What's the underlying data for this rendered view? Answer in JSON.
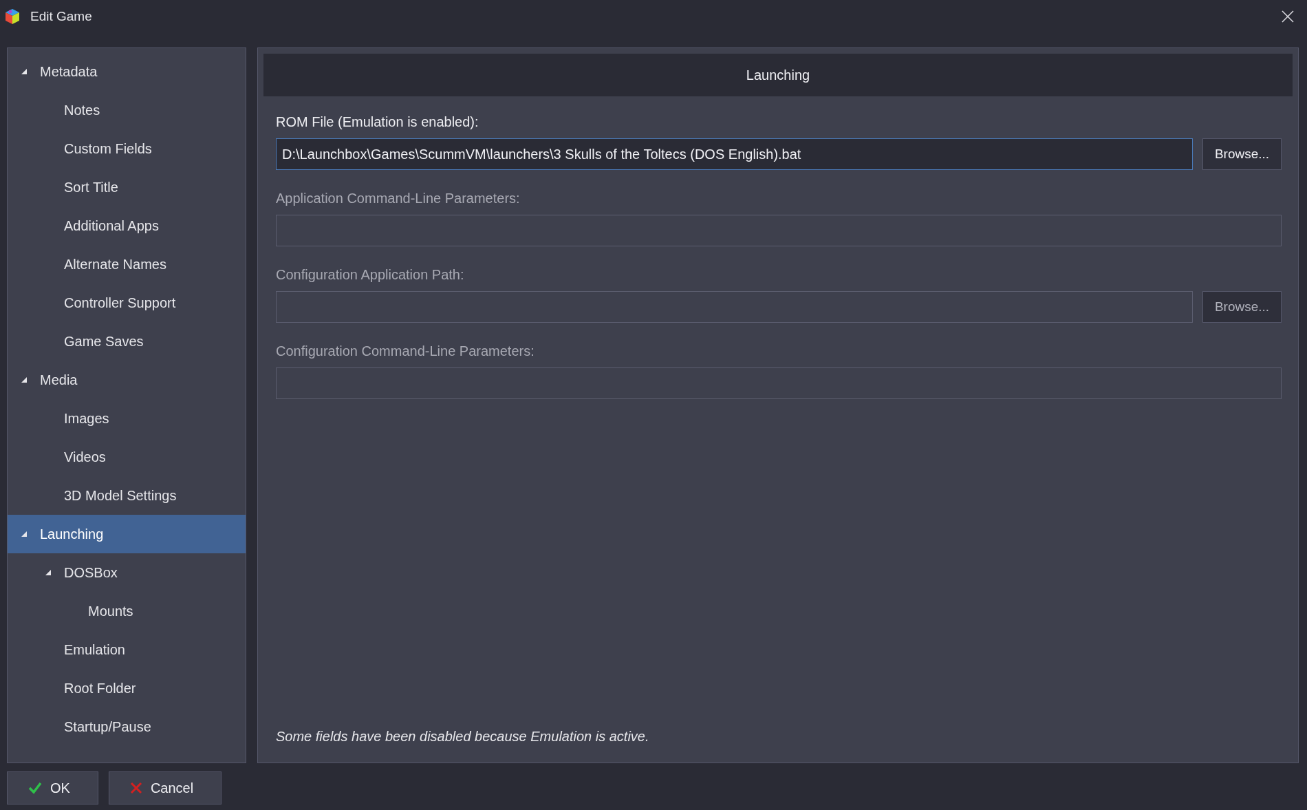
{
  "window": {
    "title": "Edit Game"
  },
  "sidebar": {
    "items": [
      {
        "label": "Metadata",
        "expanded": true,
        "selected": false,
        "children": [
          {
            "label": "Notes",
            "selected": false
          },
          {
            "label": "Custom Fields",
            "selected": false
          },
          {
            "label": "Sort Title",
            "selected": false
          },
          {
            "label": "Additional Apps",
            "selected": false
          },
          {
            "label": "Alternate Names",
            "selected": false
          },
          {
            "label": "Controller Support",
            "selected": false
          },
          {
            "label": "Game Saves",
            "selected": false
          }
        ]
      },
      {
        "label": "Media",
        "expanded": true,
        "selected": false,
        "children": [
          {
            "label": "Images",
            "selected": false
          },
          {
            "label": "Videos",
            "selected": false
          },
          {
            "label": "3D Model Settings",
            "selected": false
          }
        ]
      },
      {
        "label": "Launching",
        "expanded": true,
        "selected": true,
        "children": [
          {
            "label": "DOSBox",
            "expanded": true,
            "selected": false,
            "children": [
              {
                "label": "Mounts",
                "selected": false
              }
            ]
          },
          {
            "label": "Emulation",
            "selected": false
          },
          {
            "label": "Root Folder",
            "selected": false
          },
          {
            "label": "Startup/Pause",
            "selected": false
          }
        ]
      }
    ]
  },
  "panel": {
    "title": "Launching",
    "fields": [
      {
        "label": "ROM File (Emulation is enabled):",
        "value": "D:\\Launchbox\\Games\\ScummVM\\launchers\\3 Skulls of the Toltecs (DOS English).bat",
        "disabled": false,
        "focused": true,
        "browse": "Browse..."
      },
      {
        "label": "Application Command-Line Parameters:",
        "disabled": true,
        "focused": false
      },
      {
        "label": "Configuration Application Path:",
        "disabled": true,
        "focused": false,
        "browse": "Browse..."
      },
      {
        "label": "Configuration Command-Line Parameters:",
        "disabled": true,
        "focused": false
      }
    ],
    "note": "Some fields have been disabled because Emulation is active."
  },
  "buttons": [
    {
      "kind": "ok",
      "label": "OK"
    },
    {
      "kind": "cancel",
      "label": "Cancel"
    }
  ]
}
